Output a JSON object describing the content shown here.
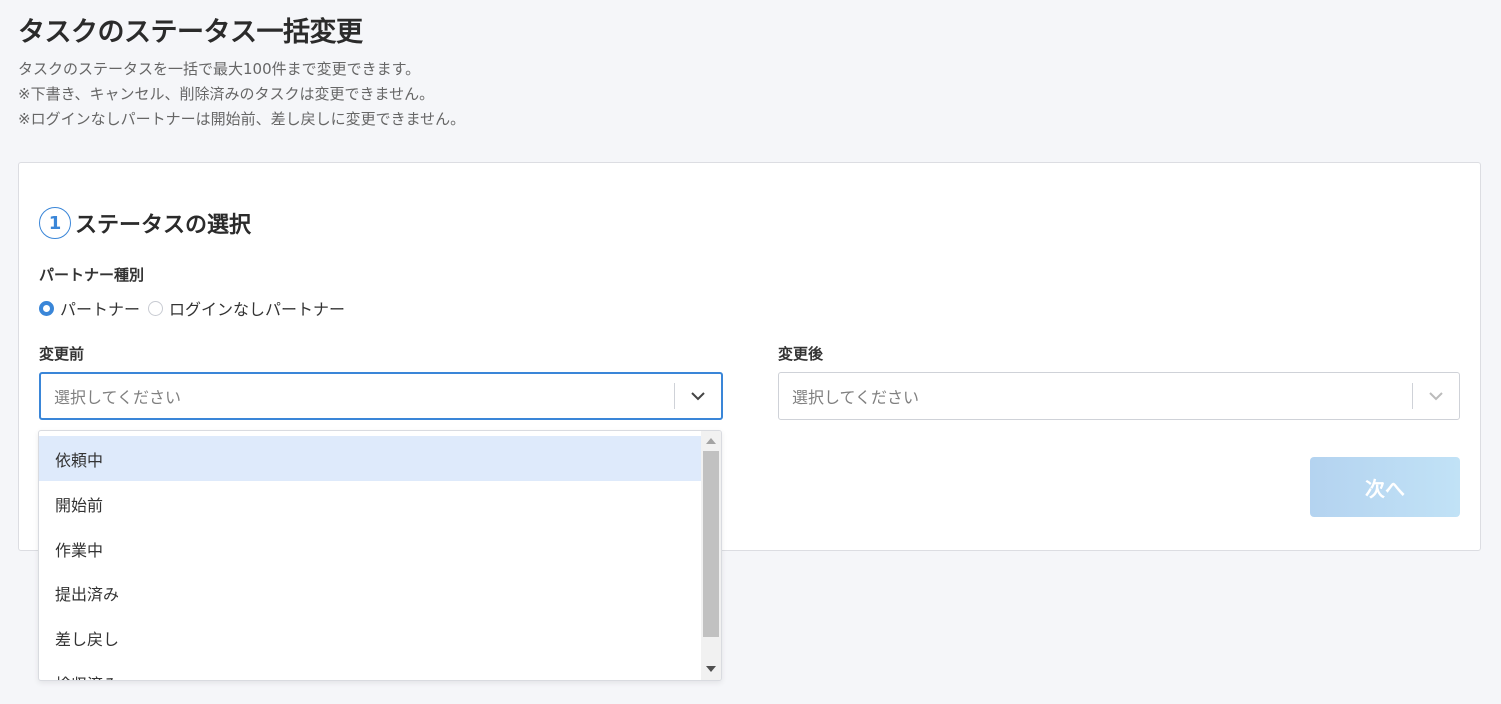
{
  "page": {
    "title": "タスクのステータス一括変更",
    "description": [
      "タスクのステータスを一括で最大100件まで変更できます。",
      "※下書き、キャンセル、削除済みのタスクは変更できません。",
      "※ログインなしパートナーは開始前、差し戻しに変更できません。"
    ]
  },
  "step": {
    "number": "1",
    "title": "ステータスの選択"
  },
  "partner_type": {
    "label": "パートナー種別",
    "options": [
      "パートナー",
      "ログインなしパートナー"
    ],
    "selected": "パートナー"
  },
  "before": {
    "label": "変更前",
    "placeholder": "選択してください"
  },
  "after": {
    "label": "変更後",
    "placeholder": "選択してください"
  },
  "dropdown": {
    "options": [
      "依頼中",
      "開始前",
      "作業中",
      "提出済み",
      "差し戻し",
      "検収済み"
    ],
    "highlighted": "依頼中"
  },
  "buttons": {
    "next": "次へ"
  },
  "icons": {
    "select_arrow": "chevron-down-icon"
  },
  "colors": {
    "accent": "#3a86d8",
    "highlight": "#deeafb",
    "disabled_button": "#b8d8f2"
  }
}
